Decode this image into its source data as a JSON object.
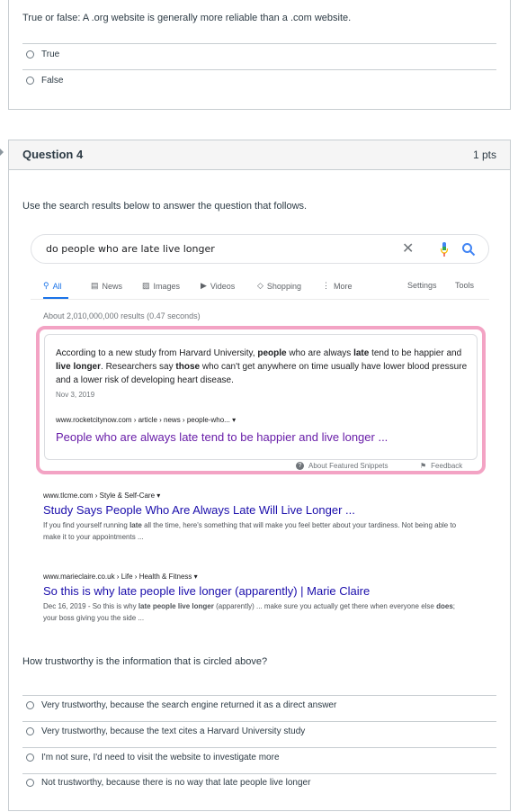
{
  "question3": {
    "text": "True or false: A .org website is generally more reliable than a .com website.",
    "answers": [
      "True",
      "False"
    ]
  },
  "question4": {
    "title": "Question 4",
    "points": "1 pts",
    "instructions": "Use the search results below to answer the question that follows.",
    "prompt": "How trustworthy is the information that is circled above?",
    "answers": [
      "Very trustworthy, because the search engine returned it as a direct answer",
      "Very trustworthy, because the text cites a Harvard University study",
      "I'm not sure, I'd need to visit the website to investigate more",
      "Not trustworthy, because there is no way that late people live longer"
    ]
  },
  "search": {
    "query": "do people who are late live longer",
    "tabs": [
      "All",
      "News",
      "Images",
      "Videos",
      "Shopping",
      "More"
    ],
    "settings": "Settings",
    "tools": "Tools",
    "stats": "About 2,010,000,000 results (0.47 seconds)",
    "featured": {
      "t1": "According to a new study from Harvard University, ",
      "b1": "people",
      "t2": " who are always ",
      "b2": "late",
      "t3": " tend to be happier and ",
      "b3": "live longer",
      "t4": ". Researchers say ",
      "b4": "those",
      "t5": " who can't get anywhere on time usually have lower blood pressure and a lower risk of developing heart disease.",
      "date": "Nov 3, 2019",
      "url": "www.rocketcitynow.com › article › news › people-who... ▾",
      "link": "People who are always late tend to be happier and live longer ...",
      "about": "About Featured Snippets",
      "feedback": "Feedback"
    },
    "results": [
      {
        "url": "www.tlcme.com › Style & Self-Care ▾",
        "title": "Study Says People Who Are Always Late Will Live Longer ...",
        "s1": "If you find yourself running ",
        "sb1": "late",
        "s2": " all the time, here's something that will make you feel better about your tardiness. Not being able to make it to your appointments ..."
      },
      {
        "url": "www.marieclaire.co.uk › Life › Health & Fitness ▾",
        "title": "So this is why late people live longer (apparently) | Marie Claire",
        "s1": "Dec 16, 2019 - So this is why ",
        "sb1": "late people live longer",
        "s2": " (apparently) ... make sure you actually get there when everyone else ",
        "sb2": "does",
        "s3": "; your boss giving you the side ..."
      }
    ]
  },
  "colors": {
    "highlight_outline": "#f3a3c4",
    "link_blue": "#1a0dab",
    "visited_purple": "#681da8",
    "accent_blue": "#1a73e8"
  }
}
